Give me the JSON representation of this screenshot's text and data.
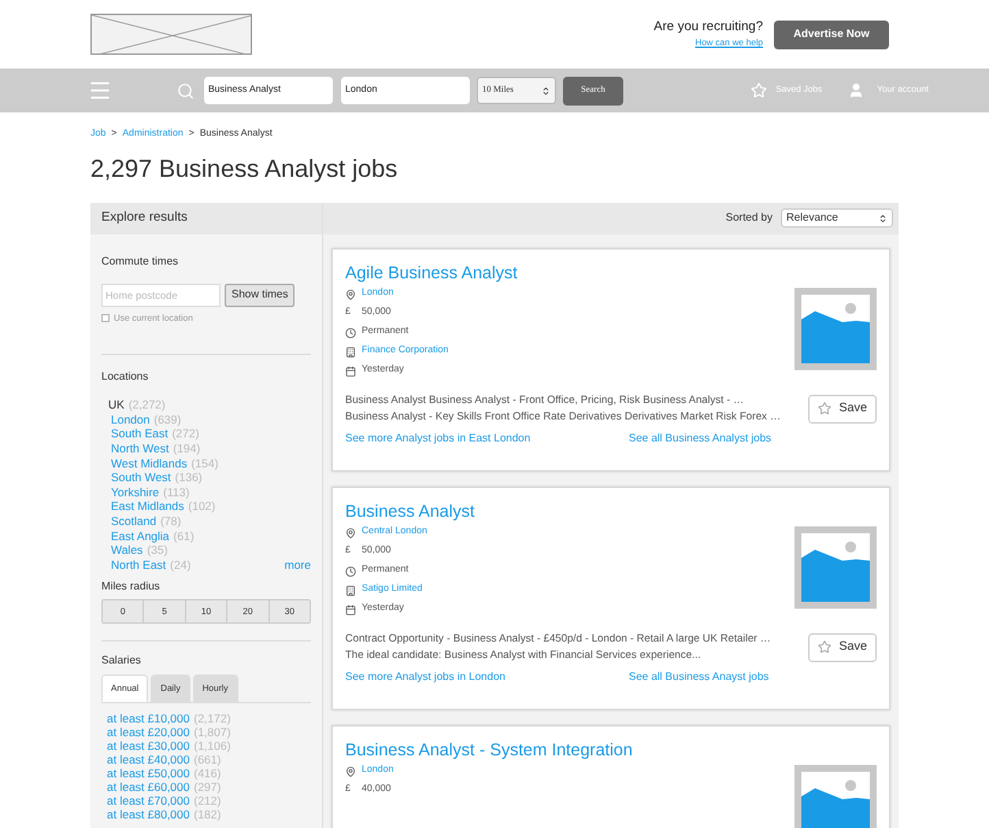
{
  "header": {
    "recruiting_question": "Are you recruiting?",
    "help_link": "How can we help",
    "advertise_button": "Advertise Now"
  },
  "navbar": {
    "keywords_value": "Business Analyst",
    "location_value": "London",
    "distance_value": "10 Miles",
    "search_button": "Search",
    "saved_jobs": "Saved Jobs",
    "account": "Your account"
  },
  "breadcrumb": [
    {
      "label": "Job",
      "link": true
    },
    {
      "label": "Administration",
      "link": true
    },
    {
      "label": "Business Analyst",
      "link": false
    }
  ],
  "breadcrumb_separator": ">",
  "page_title": "2,297 Business Analyst jobs",
  "sidebar": {
    "title": "Explore results",
    "commute": {
      "heading": "Commute times",
      "placeholder": "Home postcode",
      "button": "Show times",
      "checkbox_label": "Use current location",
      "checked": false
    },
    "locations": {
      "heading": "Locations",
      "root": {
        "label": "UK",
        "count": "(2,272)"
      },
      "items": [
        {
          "label": "London",
          "count": "(639)"
        },
        {
          "label": "South East",
          "count": "(272)"
        },
        {
          "label": "North West",
          "count": "(194)"
        },
        {
          "label": "West Midlands",
          "count": "(154)"
        },
        {
          "label": "South West",
          "count": "(136)"
        },
        {
          "label": "Yorkshire",
          "count": "(113)"
        },
        {
          "label": "East Midlands",
          "count": "(102)"
        },
        {
          "label": "Scotland",
          "count": "(78)"
        },
        {
          "label": "East Anglia",
          "count": "(61)"
        },
        {
          "label": "Wales",
          "count": "(35)"
        },
        {
          "label": "North East",
          "count": "(24)"
        }
      ],
      "more": "more"
    },
    "miles_radius": {
      "heading": "Miles radius",
      "options": [
        "0",
        "5",
        "10",
        "20",
        "30"
      ]
    },
    "salaries": {
      "heading": "Salaries",
      "tabs": [
        {
          "label": "Annual",
          "selected": true
        },
        {
          "label": "Daily",
          "selected": false
        },
        {
          "label": "Hourly",
          "selected": false
        }
      ],
      "items": [
        {
          "label": "at least £10,000",
          "count": "(2,172)"
        },
        {
          "label": "at least £20,000",
          "count": "(1,807)"
        },
        {
          "label": "at least £30,000",
          "count": "(1,106)"
        },
        {
          "label": "at least £40,000",
          "count": "(661)"
        },
        {
          "label": "at least £50,000",
          "count": "(416)"
        },
        {
          "label": "at least £60,000",
          "count": "(297)"
        },
        {
          "label": "at least £70,000",
          "count": "(212)"
        },
        {
          "label": "at least £80,000",
          "count": "(182)"
        }
      ]
    }
  },
  "results": {
    "sort_label": "Sorted by",
    "sort_value": "Relevance",
    "jobs": [
      {
        "title": "Agile Business Analyst",
        "meta": [
          {
            "kind": "location",
            "text": "London"
          },
          {
            "kind": "salary",
            "symbol": "£",
            "text": "50,000"
          },
          {
            "kind": "contract",
            "text": "Permanent"
          },
          {
            "kind": "company",
            "text": "Finance Corporation"
          },
          {
            "kind": "posted",
            "text": "Yesterday"
          }
        ],
        "description": "Business Analyst Business Analyst - Front Office, Pricing, Risk Business Analyst - … Business Analyst - Key Skills Front Office Rate Derivatives Derivatives Market Risk Forex …",
        "save": "Save",
        "links": [
          "See more Analyst jobs in East London",
          "See all Business Analyst jobs"
        ]
      },
      {
        "title": "Business Analyst",
        "meta": [
          {
            "kind": "location",
            "text": "Central London"
          },
          {
            "kind": "salary",
            "symbol": "£",
            "text": "50,000"
          },
          {
            "kind": "contract",
            "text": "Permanent"
          },
          {
            "kind": "company",
            "text": "Satigo Limited"
          },
          {
            "kind": "posted",
            "text": "Yesterday"
          }
        ],
        "description": "Contract Opportunity - Business Analyst - £450p/d - London - Retail A large UK Retailer … The ideal candidate: Business Analyst with Financial Services experience...",
        "save": "Save",
        "links": [
          "See more Analyst jobs in London",
          "See all Business Anayst jobs"
        ]
      },
      {
        "title": "Business Analyst - System Integration",
        "meta": [
          {
            "kind": "location",
            "text": "London"
          },
          {
            "kind": "salary",
            "symbol": "£",
            "text": "40,000"
          }
        ]
      }
    ]
  }
}
